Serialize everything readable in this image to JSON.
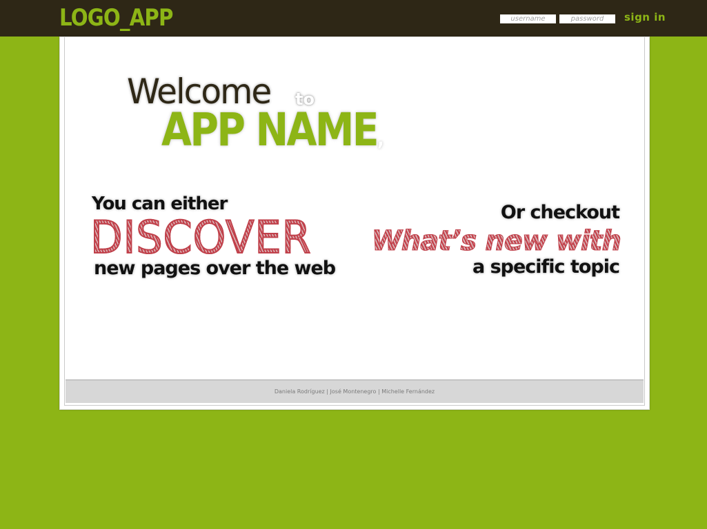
{
  "header": {
    "logo": "LOGO_APP",
    "username_placeholder": "username",
    "password_placeholder": "password",
    "signin_label": "sign in"
  },
  "hero": {
    "welcome": "Welcome",
    "to": "to",
    "app_name": "APP NAME",
    "comma": ","
  },
  "discover_block": {
    "line1": "You can either",
    "highlight": "DISCOVER",
    "line3": "new pages over the web"
  },
  "topic_block": {
    "line1": "Or checkout",
    "highlight": "What’s new with",
    "line3": "a specific topic"
  },
  "footer": {
    "credits": "Daniela Rodríguez | José Montenegro | Michelle Fernández"
  },
  "colors": {
    "background": "#8db516",
    "topbar": "#2e2716",
    "accent_red": "#c0414b",
    "footer_bg": "#d7d7d7"
  }
}
